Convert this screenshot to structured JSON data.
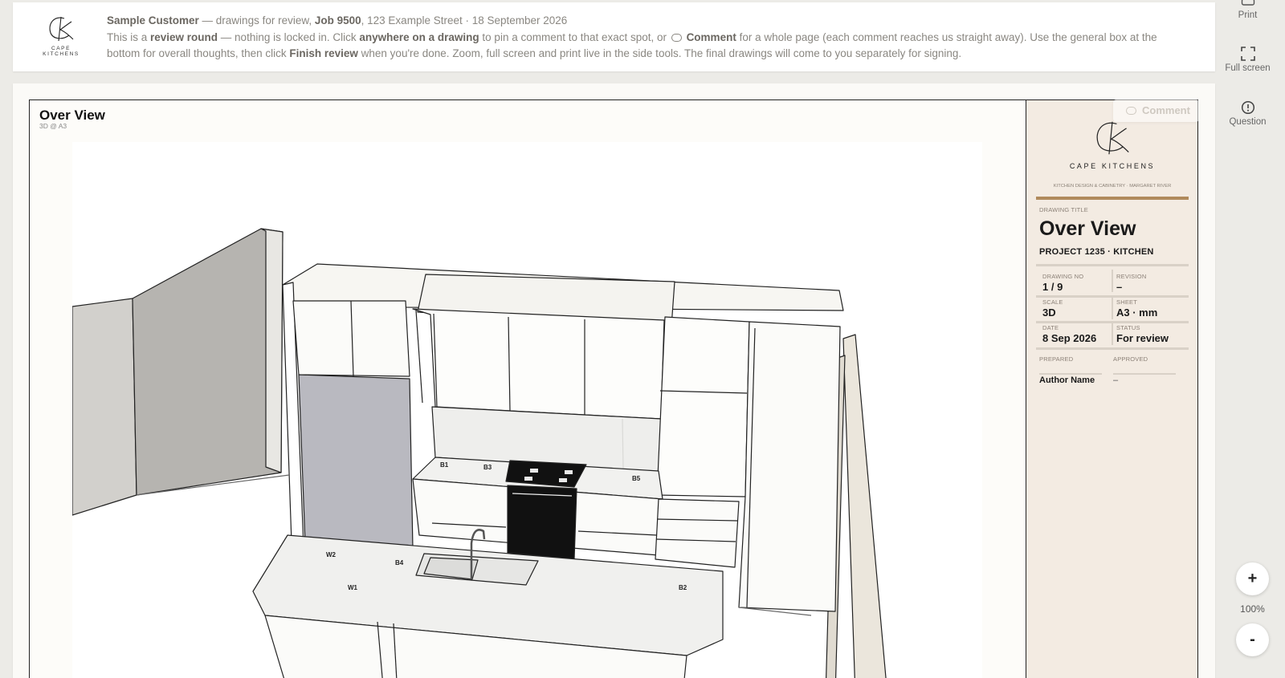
{
  "banner": {
    "brand_wordmark": "CAPE KITCHENS",
    "customer": "Sample Customer",
    "intro_mid": " — drawings for review, ",
    "job_label": "Job 9500",
    "address_date": ", 123 Example Street · 18 September 2026",
    "p1": "This is a ",
    "b1": "review round",
    "p2": " — nothing is locked in. Click ",
    "b2": "anywhere on a drawing",
    "p3": " to pin a comment to that exact spot, or ",
    "b3": "Comment",
    "p4": " for a whole page (each comment reaches us straight away). Use the general box at the bottom for overall thoughts, then click ",
    "b4": "Finish review",
    "p5": " when you're done. Zoom, full screen and print live in the side tools. The final drawings will come to you separately for signing."
  },
  "toolbar": {
    "print_label": "Print",
    "fullscreen_label": "Full screen",
    "question_label": "Question",
    "zoom_in": "+",
    "zoom_out": "-",
    "zoom_level": "100%"
  },
  "sheet": {
    "title": "Over View",
    "subtitle": "3D @ A3",
    "comment_label": "Comment",
    "tags": [
      "B1",
      "B3",
      "B5",
      "W2",
      "B4",
      "W1",
      "B2"
    ]
  },
  "title_block": {
    "brand": "CAPE KITCHENS",
    "tagline": "KITCHEN DESIGN & CABINETRY · MARGARET RIVER",
    "drawing_title_label": "DRAWING TITLE",
    "drawing_title": "Over View",
    "project": "PROJECT 1235 · KITCHEN",
    "drawing_no_label": "DRAWING NO",
    "drawing_no": "1 / 9",
    "revision_label": "REVISION",
    "revision": "–",
    "scale_label": "SCALE",
    "scale": "3D",
    "sheet_label": "SHEET",
    "sheet": "A3 · mm",
    "date_label": "DATE",
    "date": "8 Sep 2026",
    "status_label": "STATUS",
    "status": "For review",
    "prepared_label": "PREPARED",
    "approved_label": "APPROVED",
    "prepared_by": "Author Name",
    "approved_by": "–"
  }
}
